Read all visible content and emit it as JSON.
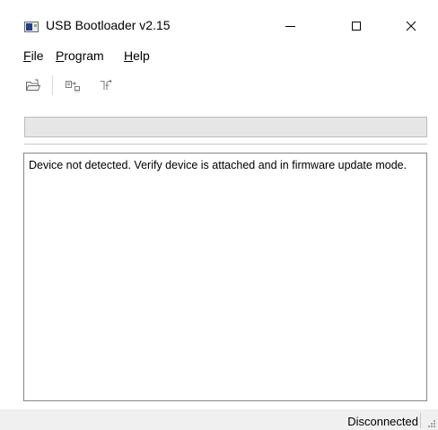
{
  "window": {
    "title": "USB Bootloader v2.15",
    "icon": "app-icon"
  },
  "menu": {
    "file": {
      "mnemonic": "F",
      "rest": "ile"
    },
    "program": {
      "mnemonic": "P",
      "rest": "rogram"
    },
    "help": {
      "mnemonic": "H",
      "rest": "elp"
    }
  },
  "toolbar": {
    "icons": [
      "open-folder-icon",
      "program-device-icon",
      "reset-device-icon"
    ]
  },
  "progress": {
    "value_percent": 0
  },
  "log": {
    "text": "Device not detected.  Verify device is attached and in firmware update mode."
  },
  "status": {
    "connection": "Disconnected"
  },
  "colors": {
    "progress_fill": "#06b025",
    "status_bar": "#f0f0f0",
    "border": "#828790"
  }
}
